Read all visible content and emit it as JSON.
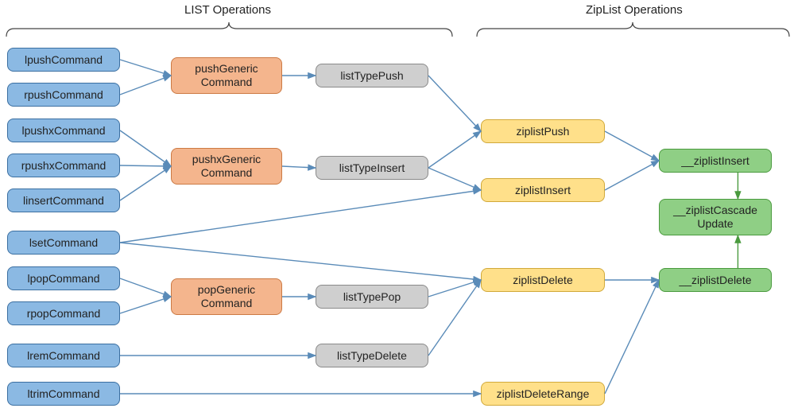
{
  "sections": {
    "list_ops": "LIST Operations",
    "ziplist_ops": "ZipList Operations"
  },
  "nodes": {
    "lpushCommand": "lpushCommand",
    "rpushCommand": "rpushCommand",
    "lpushxCommand": "lpushxCommand",
    "rpushxCommand": "rpushxCommand",
    "linsertCommand": "linsertCommand",
    "lsetCommand": "lsetCommand",
    "lpopCommand": "lpopCommand",
    "rpopCommand": "rpopCommand",
    "lremCommand": "lremCommand",
    "ltrimCommand": "ltrimCommand",
    "pushGenericCommand": "pushGeneric\nCommand",
    "pushxGenericCommand": "pushxGeneric\nCommand",
    "popGenericCommand": "popGeneric\nCommand",
    "listTypePush": "listTypePush",
    "listTypeInsert": "listTypeInsert",
    "listTypePop": "listTypePop",
    "listTypeDelete": "listTypeDelete",
    "ziplistPush": "ziplistPush",
    "ziplistInsert": "ziplistInsert",
    "ziplistDelete": "ziplistDelete",
    "ziplistDeleteRange": "ziplistDeleteRange",
    "__ziplistInsert": "__ziplistInsert",
    "__ziplistCascadeUpdate": "__ziplistCascade\nUpdate",
    "__ziplistDelete": "__ziplistDelete"
  },
  "edges": [
    [
      "lpushCommand",
      "pushGenericCommand"
    ],
    [
      "rpushCommand",
      "pushGenericCommand"
    ],
    [
      "lpushxCommand",
      "pushxGenericCommand"
    ],
    [
      "rpushxCommand",
      "pushxGenericCommand"
    ],
    [
      "linsertCommand",
      "pushxGenericCommand"
    ],
    [
      "lpopCommand",
      "popGenericCommand"
    ],
    [
      "rpopCommand",
      "popGenericCommand"
    ],
    [
      "pushGenericCommand",
      "listTypePush"
    ],
    [
      "pushxGenericCommand",
      "listTypeInsert"
    ],
    [
      "popGenericCommand",
      "listTypePop"
    ],
    [
      "lremCommand",
      "listTypeDelete"
    ],
    [
      "listTypePush",
      "ziplistPush"
    ],
    [
      "listTypeInsert",
      "ziplistPush"
    ],
    [
      "listTypeInsert",
      "ziplistInsert"
    ],
    [
      "lsetCommand",
      "ziplistInsert"
    ],
    [
      "lsetCommand",
      "ziplistDelete"
    ],
    [
      "listTypePop",
      "ziplistDelete"
    ],
    [
      "listTypeDelete",
      "ziplistDelete"
    ],
    [
      "ltrimCommand",
      "ziplistDeleteRange"
    ],
    [
      "ziplistPush",
      "__ziplistInsert"
    ],
    [
      "ziplistInsert",
      "__ziplistInsert"
    ],
    [
      "ziplistDelete",
      "__ziplistDelete"
    ],
    [
      "ziplistDeleteRange",
      "__ziplistDelete"
    ]
  ],
  "green_edges": [
    [
      "__ziplistInsert",
      "__ziplistCascadeUpdate"
    ],
    [
      "__ziplistDelete",
      "__ziplistCascadeUpdate"
    ]
  ]
}
